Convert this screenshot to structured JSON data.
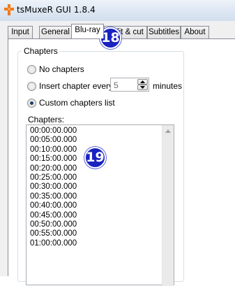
{
  "window": {
    "title": "tsMuxeR GUI 1.8.4",
    "icon": "orange-cross-icon"
  },
  "tabs": [
    {
      "label": "Input",
      "active": false
    },
    {
      "label": "General",
      "active": false
    },
    {
      "label": "Blu-ray",
      "active": true
    },
    {
      "label": "Split & cut",
      "active": false
    },
    {
      "label": "Subtitles",
      "active": false
    },
    {
      "label": "About",
      "active": false
    }
  ],
  "chapters_group": {
    "title": "Chapters",
    "option_no_chapters": "No chapters",
    "option_insert_every": "Insert chapter every",
    "interval_value": "5",
    "interval_unit": "minutes",
    "option_custom_list": "Custom chapters list",
    "selected": "Custom chapters list",
    "list_label": "Chapters:",
    "list_text": "00:00:00.000\n00:05:00.000\n00:10:00.000\n00:15:00.000\n00:20:00.000\n00:25:00.000\n00:30:00.000\n00:35:00.000\n00:40:00.000\n00:45:00.000\n00:50:00.000\n00:55:00.000\n01:00:00.000"
  },
  "callouts": {
    "tab_callout": "18",
    "list_callout": "19"
  },
  "colors": {
    "callout": "#1a22c0",
    "icon": "#f07a1a"
  }
}
